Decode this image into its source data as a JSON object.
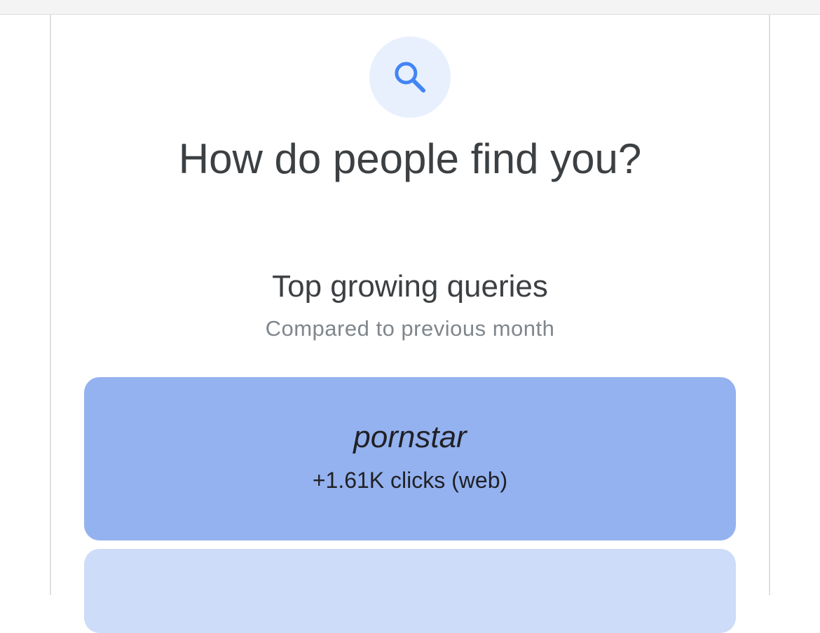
{
  "header": {
    "title": "How do people find you?",
    "icon": "search-icon"
  },
  "section": {
    "title": "Top growing queries",
    "subtitle": "Compared to previous month"
  },
  "queries": [
    {
      "term": "pornstar",
      "metric": "+1.61K clicks (web)"
    }
  ],
  "colors": {
    "icon_bg": "#e8f0fe",
    "icon_fg": "#4285f4",
    "card_primary": "#94b2f0",
    "card_secondary": "#cddcf8",
    "text_primary": "#3c4043",
    "text_secondary": "#80868b"
  }
}
